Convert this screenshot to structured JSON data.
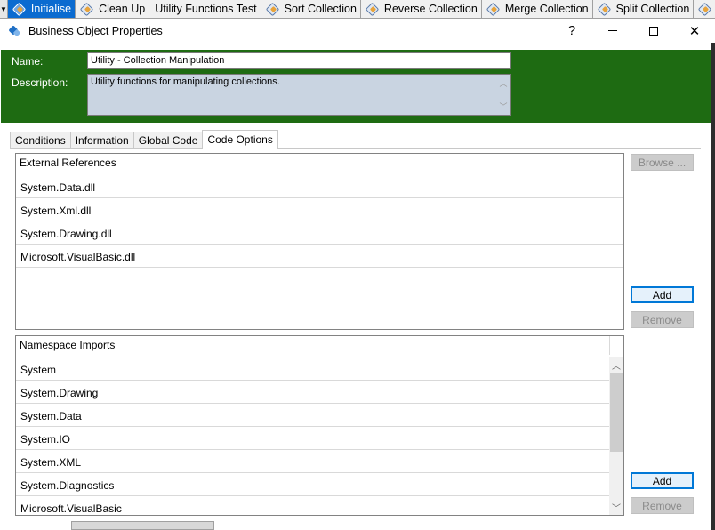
{
  "tabstrip": {
    "tabs": [
      {
        "label": "Initialise",
        "active": true,
        "icon": "object-icon"
      },
      {
        "label": "Clean Up",
        "active": false,
        "icon": "object-icon"
      },
      {
        "label": "Utility Functions Test",
        "active": false,
        "icon": ""
      },
      {
        "label": "Sort Collection",
        "active": false,
        "icon": "object-icon"
      },
      {
        "label": "Reverse Collection",
        "active": false,
        "icon": "object-icon"
      },
      {
        "label": "Merge Collection",
        "active": false,
        "icon": "object-icon"
      },
      {
        "label": "Split Collection",
        "active": false,
        "icon": "object-icon"
      }
    ]
  },
  "window": {
    "title": "Business Object Properties",
    "help": "?",
    "close": "✕"
  },
  "header": {
    "name_label": "Name:",
    "name_value": "Utility - Collection Manipulation",
    "description_label": "Description:",
    "description_value": "Utility functions for manipulating collections."
  },
  "tabs": [
    {
      "label": "Conditions",
      "active": false
    },
    {
      "label": "Information",
      "active": false
    },
    {
      "label": "Global Code",
      "active": false
    },
    {
      "label": "Code Options",
      "active": true
    }
  ],
  "external_references": {
    "header": "External References",
    "items": [
      "System.Data.dll",
      "System.Xml.dll",
      "System.Drawing.dll",
      "Microsoft.VisualBasic.dll"
    ],
    "browse_label": "Browse ...",
    "add_label": "Add",
    "remove_label": "Remove"
  },
  "namespace_imports": {
    "header": "Namespace Imports",
    "items": [
      "System",
      "System.Drawing",
      "System.Data",
      "System.IO",
      "System.XML",
      "System.Diagnostics",
      "Microsoft.VisualBasic"
    ],
    "add_label": "Add",
    "remove_label": "Remove"
  },
  "colors": {
    "header_green": "#1e6b12",
    "active_tab_blue": "#0b6bd0",
    "description_bg": "#c9d4e1"
  }
}
